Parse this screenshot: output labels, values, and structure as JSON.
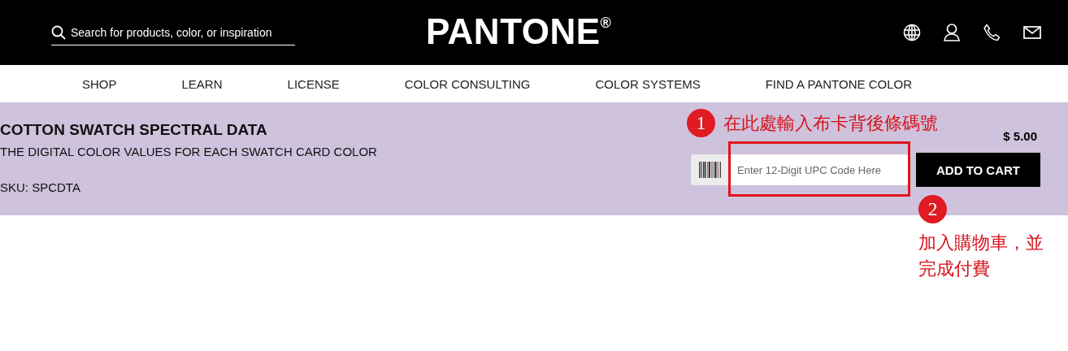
{
  "header": {
    "search": {
      "placeholder": "Search for products, color, or inspiration"
    },
    "logo": "PANTONE$^{®}$"
  },
  "nav": {
    "items": [
      {
        "label": "SHOP"
      },
      {
        "label": "LEARN"
      },
      {
        "label": "LICENSE"
      },
      {
        "label": "COLOR CONSULTING"
      },
      {
        "label": "COLOR SYSTEMS"
      },
      {
        "label": "FIND A PANTONE COLOR"
      }
    ]
  },
  "product": {
    "title": "COTTON SWATCH SPECTRAL DATA",
    "subtitle": "THE DIGITAL COLOR VALUES FOR EACH SWATCH CARD COLOR",
    "sku": "SKU: SPCDTA",
    "price": "$ 5.00",
    "upc_field": {
      "placeholder": "Enter 12-Digit UPC Code Here"
    },
    "button": "ADD TO CART"
  },
  "annotations": [
    {
      "number": "1",
      "text": "在此處輸入布卡背後條碼號"
    },
    {
      "number": "2",
      "text": "加入購物車，並完成付費"
    }
  ]
}
